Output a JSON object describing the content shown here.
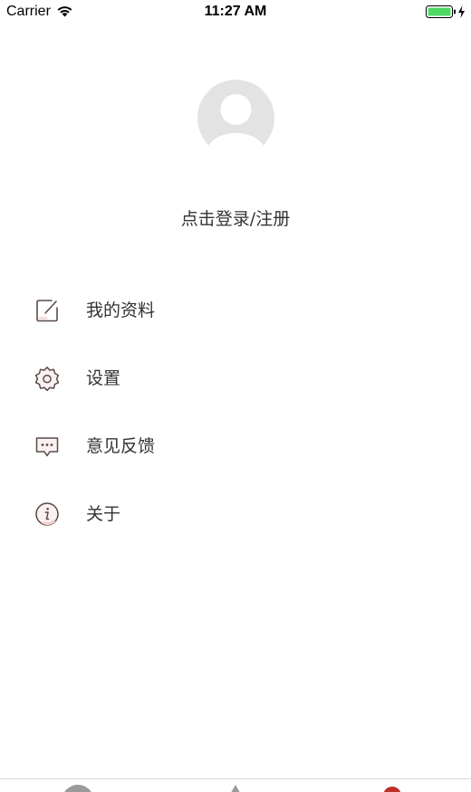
{
  "status_bar": {
    "carrier": "Carrier",
    "time": "11:27 AM",
    "wifi_icon": "wifi-icon",
    "battery_icon": "battery-charging-icon",
    "battery_color": "#4cd964"
  },
  "profile": {
    "avatar_icon": "default-avatar-icon",
    "login_label": "点击登录/注册"
  },
  "menu": {
    "items": [
      {
        "label": "我的资料",
        "icon": "edit-icon"
      },
      {
        "label": "设置",
        "icon": "gear-icon"
      },
      {
        "label": "意见反馈",
        "icon": "feedback-icon"
      },
      {
        "label": "关于",
        "icon": "info-icon"
      }
    ]
  },
  "colors": {
    "text": "#333333",
    "icon_stroke": "#5a4a4a",
    "icon_accent": "#f3dede",
    "tab_red": "#c0302a",
    "avatar": "#e3e3e3"
  }
}
